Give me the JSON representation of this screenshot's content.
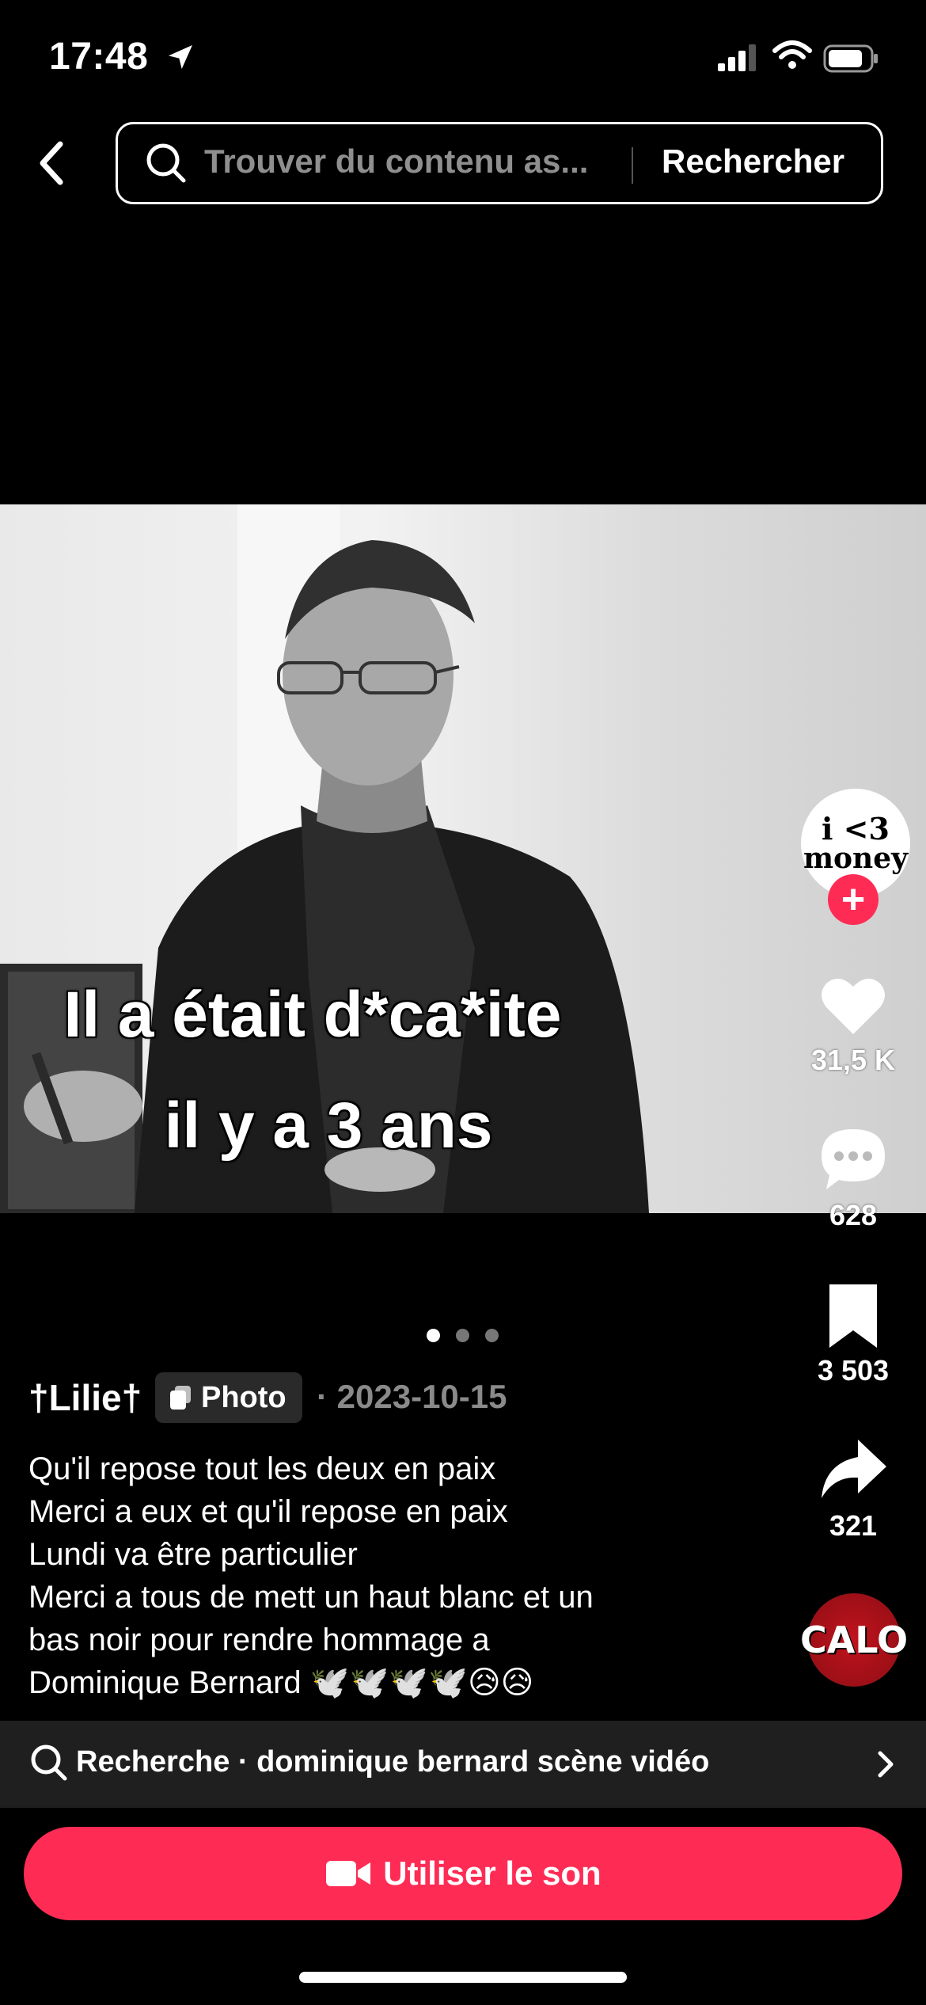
{
  "status_bar": {
    "time": "17:48"
  },
  "search": {
    "placeholder": "Trouver du contenu as...",
    "submit_label": "Rechercher"
  },
  "post": {
    "caption_lines": [
      "Il a était d*ca*ite",
      "il y a 3 ans"
    ],
    "author": "†Lilie†",
    "badge_label": "Photo",
    "date": "· 2023-10-15",
    "description_lines": [
      "Qu'il repose tout les deux en paix",
      "Merci a eux et qu'il repose en paix",
      "Lundi va être particulier",
      "Merci a tous de mett un haut blanc et un",
      "bas noir pour  rendre hommage a",
      "Dominique Bernard 🕊️🕊️🕊️🕊️😥😥"
    ],
    "carousel": {
      "count": 3,
      "active": 1
    }
  },
  "rail": {
    "avatar_text_l1": "i <3",
    "avatar_text_l2": "money",
    "likes": "31,5 K",
    "comments": "628",
    "saves": "3 503",
    "shares": "321",
    "music_disc_text": "CALO"
  },
  "related_search": {
    "text": "Recherche · dominique bernard scène vidéo"
  },
  "use_sound": {
    "label": "Utiliser le son"
  },
  "colors": {
    "accent": "#fe2c55",
    "background": "#000000"
  }
}
